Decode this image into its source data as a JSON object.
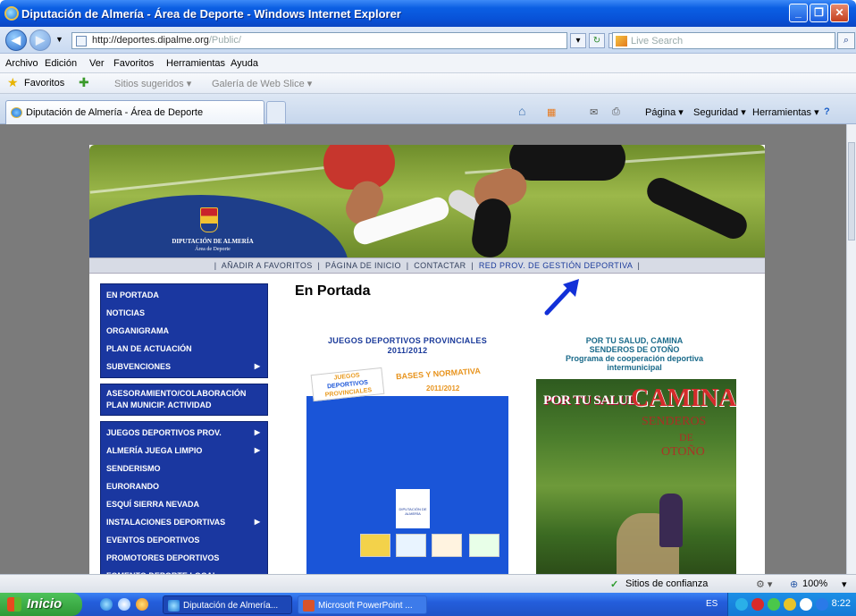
{
  "window": {
    "title": "Diputación de Almería - Área de Deporte - Windows Internet Explorer"
  },
  "address_bar": {
    "url_host": "http://deportes.dipalme.org",
    "url_path": "/Public/",
    "search_placeholder": "Live Search"
  },
  "menu": [
    "Archivo",
    "Edición",
    "Ver",
    "Favoritos",
    "Herramientas",
    "Ayuda"
  ],
  "favorites_bar": {
    "favorites": "Favoritos",
    "suggested": "Sitios sugeridos ▾",
    "webslice": "Galería de Web Slice ▾"
  },
  "tab": {
    "title": "Diputación de Almería - Área de Deporte"
  },
  "command_bar": {
    "page": "Página ▾",
    "security": "Seguridad ▾",
    "tools": "Herramientas ▾"
  },
  "site": {
    "logo_line1": "DIPUTACIÓN DE ALMERÍA",
    "logo_line2": "Área de Deporte",
    "top_links": {
      "add_favorites": "AÑADIR A FAVORITOS",
      "home": "PÁGINA DE INICIO",
      "contact": "CONTACTAR",
      "network": "RED PROV. DE GESTIÓN DEPORTIVA"
    },
    "nav_group1": [
      "EN PORTADA",
      "NOTICIAS",
      "ORGANIGRAMA",
      "PLAN DE ACTUACIÓN",
      "SUBVENCIONES"
    ],
    "nav_group2": [
      "ASESORAMIENTO/COLABORACIÓN",
      "PLAN MUNICIP. ACTIVIDAD"
    ],
    "nav_group3": [
      "JUEGOS DEPORTIVOS PROV.",
      "ALMERÍA JUEGA LIMPIO",
      "SENDERISMO",
      "EURORANDO",
      "ESQUÍ SIERRA NEVADA",
      "INSTALACIONES DEPORTIVAS",
      "EVENTOS DEPORTIVOS",
      "PROMOTORES DEPORTIVOS",
      "FOMENTO DEPORTE LOCAL"
    ],
    "heading": "En Portada",
    "juegos": {
      "title1": "JUEGOS DEPORTIVOS PROVINCIALES",
      "title2": "2011/2012",
      "logo1": "JUEGOS",
      "logo2": "DEPORTIVOS",
      "logo3": "PROVINCIALES",
      "bases": "BASES Y NORMATIVA",
      "year": "2011/2012",
      "crest": "DIPUTACIÓN DE ALMERÍA"
    },
    "salud": {
      "title1": "POR TU SALUD, CAMINA",
      "title2": "SENDEROS DE OTOÑO",
      "title3": "Programa de cooperación deportiva",
      "title4": "intermunicipal",
      "poster_a": "POR TU SALUD,",
      "poster_b": "CAMINA",
      "poster_c": "SENDEROS",
      "poster_d": "DE",
      "poster_e": "OTOÑO"
    }
  },
  "status_bar": {
    "zone": "Sitios de confianza",
    "zoom": "100%"
  },
  "taskbar": {
    "start": "Inicio",
    "task1": "Diputación de Almería...",
    "task2": "Microsoft PowerPoint ...",
    "lang": "ES",
    "clock": "8:22"
  }
}
